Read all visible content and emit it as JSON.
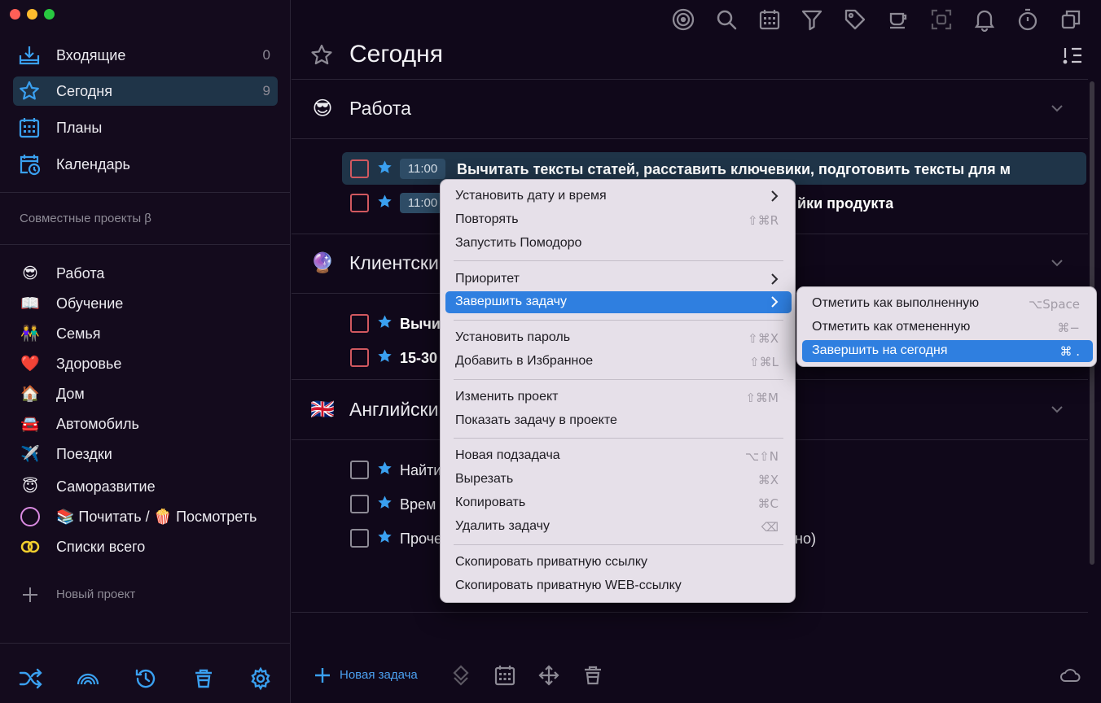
{
  "colors": {
    "accent": "#3aa0f0",
    "selection": "#2f7fe0",
    "sidebar_active": "#1f3448",
    "checkbox_red": "#d0585f"
  },
  "sidebar": {
    "nav": [
      {
        "label": "Входящие",
        "count": "0",
        "icon": "inbox-icon"
      },
      {
        "label": "Сегодня",
        "count": "9",
        "icon": "star-icon"
      },
      {
        "label": "Планы",
        "count": "",
        "icon": "calendar-grid-icon"
      },
      {
        "label": "Календарь",
        "count": "",
        "icon": "calendar-clock-icon"
      }
    ],
    "shared_label": "Совместные проекты β",
    "projects": [
      {
        "emoji": "😎",
        "label": "Работа"
      },
      {
        "emoji": "📖",
        "label": "Обучение"
      },
      {
        "emoji": "👫",
        "label": "Семья"
      },
      {
        "emoji": "❤️",
        "label": "Здоровье"
      },
      {
        "emoji": "🏠",
        "label": "Дом"
      },
      {
        "emoji": "🚘",
        "label": "Автомобиль"
      },
      {
        "emoji": "✈️",
        "label": "Поездки"
      },
      {
        "emoji": "😇",
        "label": "Саморазвитие"
      },
      {
        "emoji": "",
        "label": "📚 Почитать / 🍿 Посмотреть"
      },
      {
        "emoji": "",
        "label": "Списки всего"
      }
    ],
    "new_project": "Новый проект"
  },
  "main": {
    "title": "Сегодня",
    "sections": [
      {
        "emoji": "😎",
        "title": "Работа"
      },
      {
        "emoji": "🔮",
        "title": "Клиентски"
      },
      {
        "emoji": "🇬🇧",
        "title": "Английски"
      }
    ],
    "tasks": [
      {
        "time": "11:00",
        "text": "Вычитать тексты статей, расставить ключевики, подготовить тексты для м"
      },
      {
        "time": "11:00",
        "text": "йки продукта"
      },
      {
        "time": "",
        "text": "Вычи"
      },
      {
        "time": "",
        "text": "15-30"
      },
      {
        "time": "",
        "text": "Найти"
      },
      {
        "time": "",
        "text": "Врем"
      },
      {
        "time": "",
        "text": "Проче"
      }
    ],
    "partial_text_after_menu": "но)",
    "new_task": "Новая задача"
  },
  "context_menu": {
    "items": [
      {
        "label": "Установить дату и время",
        "shortcut": "",
        "submenu": true
      },
      {
        "label": "Повторять",
        "shortcut": "⇧⌘R"
      },
      {
        "label": "Запустить Помодоро",
        "shortcut": ""
      },
      {
        "label": "Приоритет",
        "shortcut": "",
        "submenu": true
      },
      {
        "label": "Завершить задачу",
        "shortcut": "",
        "submenu": true,
        "selected": true
      },
      {
        "label": "Установить пароль",
        "shortcut": "⇧⌘X"
      },
      {
        "label": "Добавить в Избранное",
        "shortcut": "⇧⌘L"
      },
      {
        "label": "Изменить проект",
        "shortcut": "⇧⌘M"
      },
      {
        "label": "Показать задачу в проекте",
        "shortcut": ""
      },
      {
        "label": "Новая подзадача",
        "shortcut": "⌥⇧N"
      },
      {
        "label": "Вырезать",
        "shortcut": "⌘X"
      },
      {
        "label": "Копировать",
        "shortcut": "⌘C"
      },
      {
        "label": "Удалить задачу",
        "shortcut": "⌫"
      },
      {
        "label": "Скопировать приватную ссылку",
        "shortcut": ""
      },
      {
        "label": "Скопировать приватную WEB-ссылку",
        "shortcut": ""
      }
    ]
  },
  "submenu": {
    "items": [
      {
        "label": "Отметить как выполненную",
        "shortcut": "⌥Space"
      },
      {
        "label": "Отметить как отмененную",
        "shortcut": "⌘−"
      },
      {
        "label": "Завершить на сегодня",
        "shortcut": "⌘ .",
        "selected": true
      }
    ]
  }
}
